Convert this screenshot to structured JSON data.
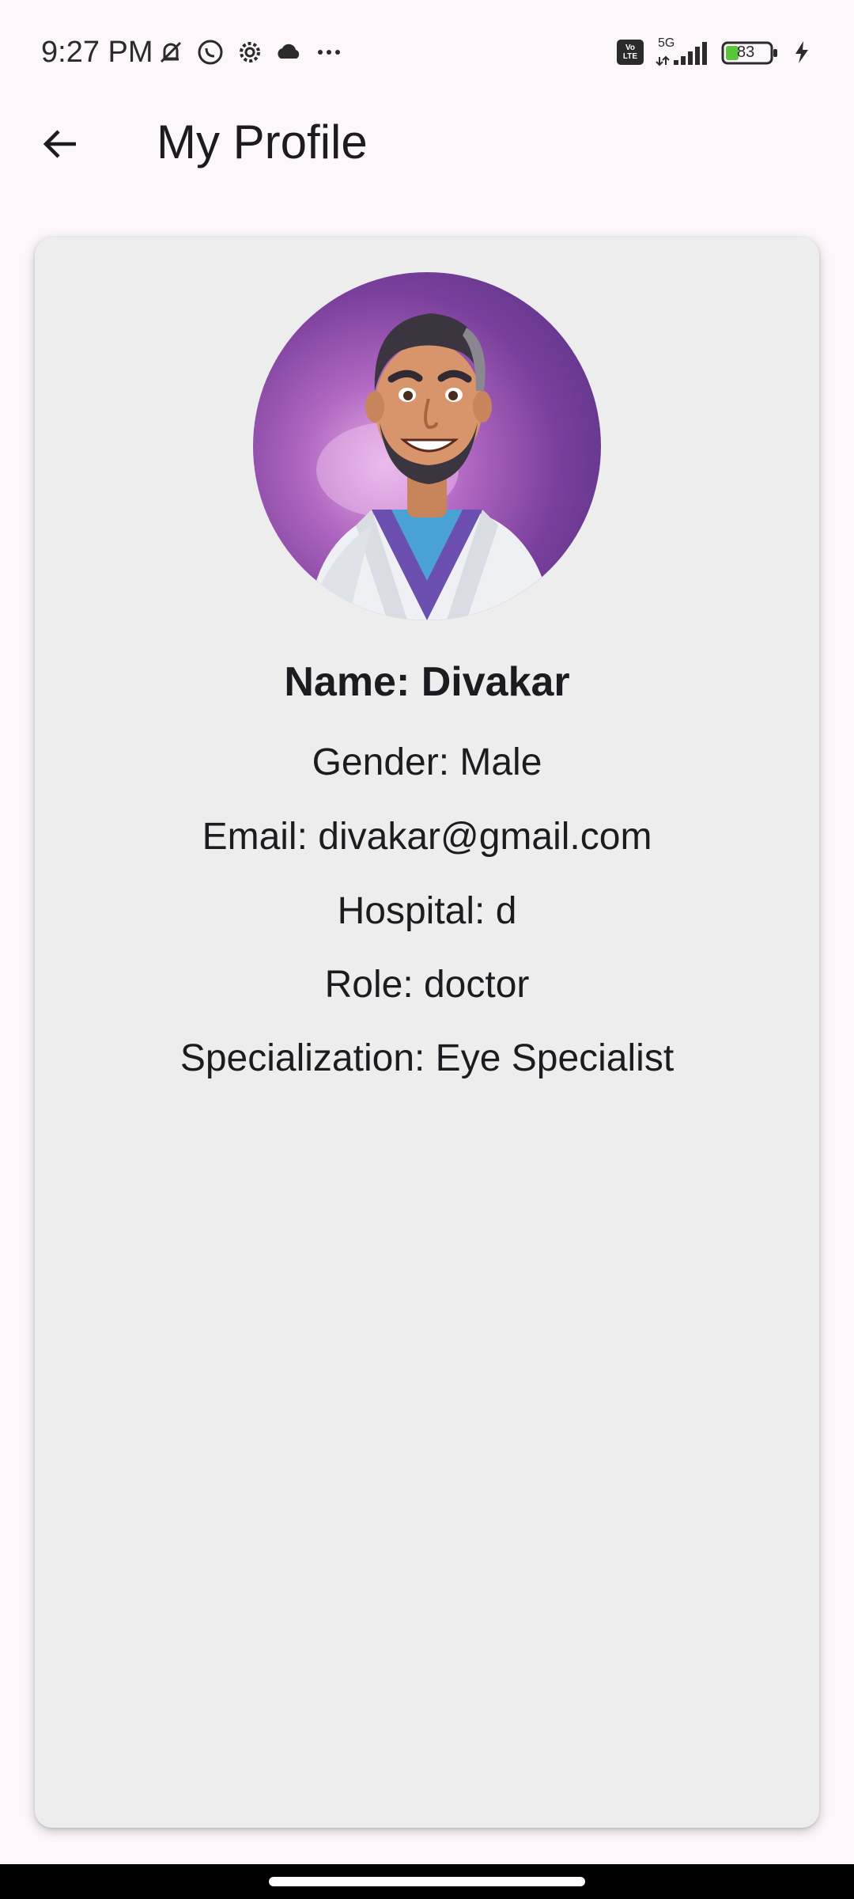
{
  "status_bar": {
    "time": "9:27 PM",
    "left_icons": [
      "mute-icon",
      "whatsapp-icon",
      "settings-icon",
      "cloud-icon",
      "more-icon"
    ],
    "network": "5G",
    "volte": "Vo LTE",
    "battery_level": "83"
  },
  "app_bar": {
    "title": "My Profile",
    "back_icon": "arrow-left-icon"
  },
  "profile": {
    "name": "Name: Divakar",
    "gender": "Gender: Male",
    "email": "Email: divakar@gmail.com",
    "hospital": "Hospital: d",
    "role": "Role: doctor",
    "specialization": "Specialization: Eye Specialist"
  },
  "colors": {
    "background": "#fdf7fc",
    "card": "#eeedee",
    "text": "#1d1b20"
  }
}
